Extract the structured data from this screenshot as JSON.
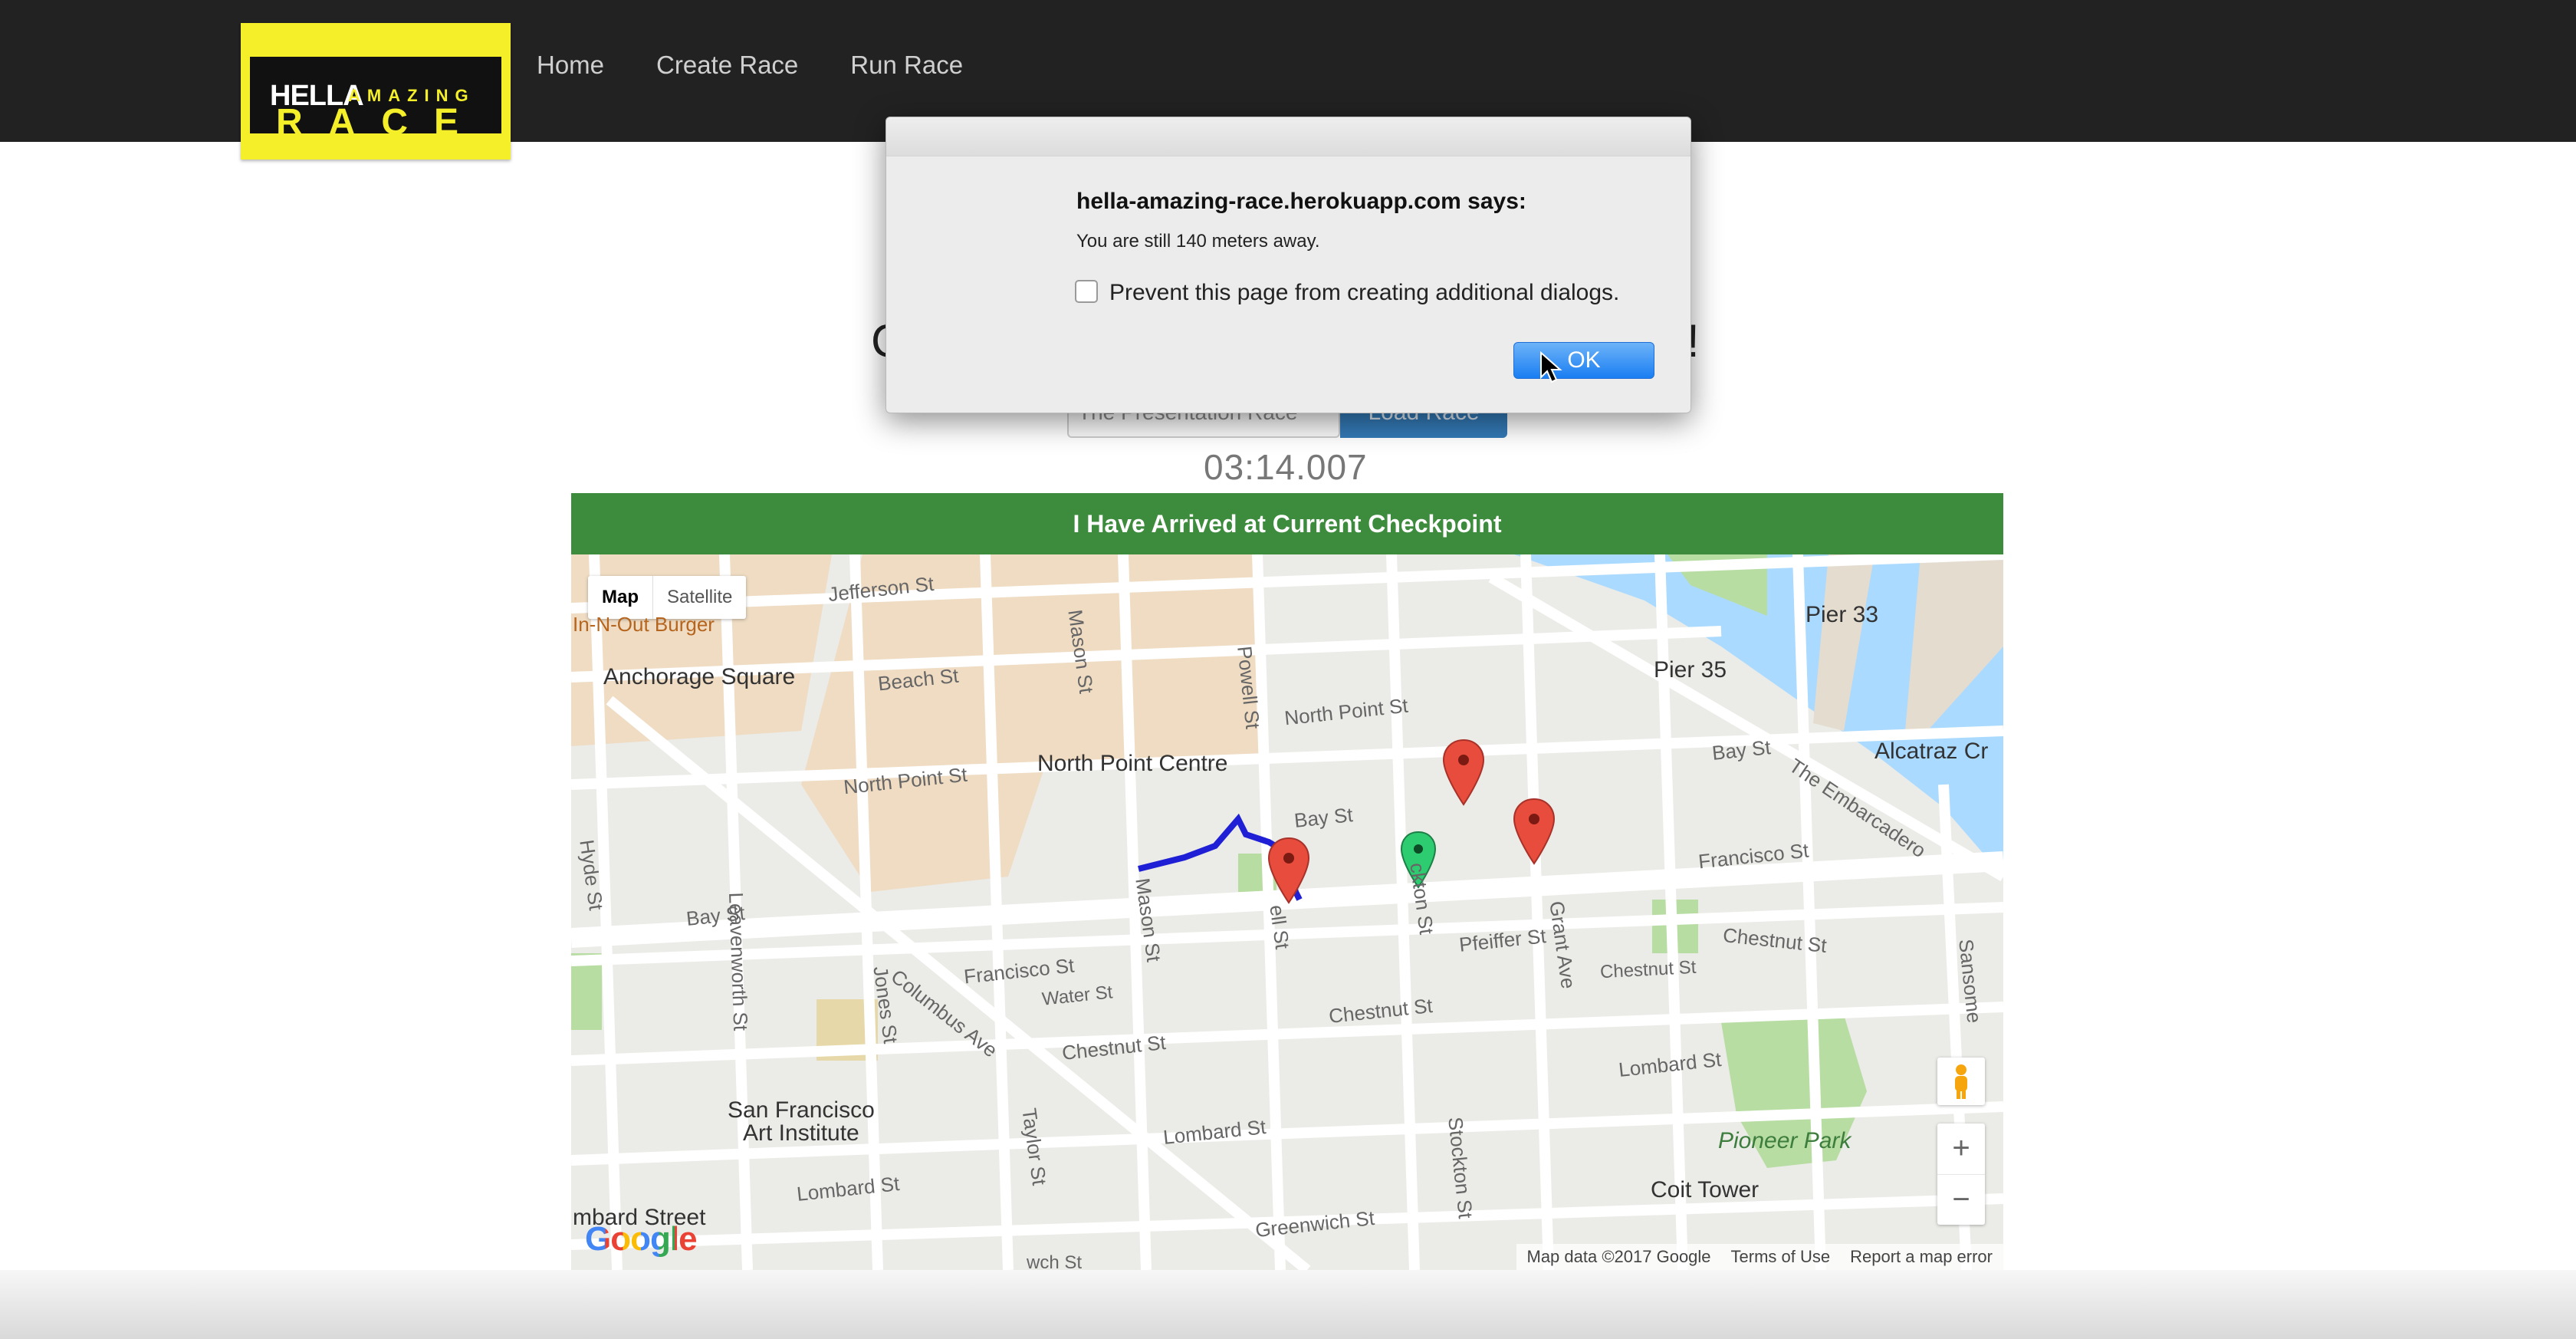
{
  "nav": {
    "logo": {
      "top": "HELLA",
      "amazing": "AMAZING",
      "bottom": "RACE"
    },
    "links": [
      "Home",
      "Create Race",
      "Run Race"
    ]
  },
  "page": {
    "heading_start": "C",
    "heading_end": "!",
    "race_input_value": "The Presentation Race",
    "load_button": "Load Race",
    "timer": "03:14.007",
    "arrive_button": "I Have Arrived at Current Checkpoint"
  },
  "map": {
    "type_map": "Map",
    "type_satellite": "Satellite",
    "labels": {
      "jefferson": "Jefferson St",
      "in_n_out": "In-N-Out Burger",
      "anchorage": "Anchorage Square",
      "beach": "Beach St",
      "mason_top": "Mason St",
      "powell": "Powell St",
      "north_point": "North Point St",
      "north_point_2": "North Point St",
      "npc": "North Point Centre",
      "bay_mid": "Bay St",
      "bay_right": "Bay St",
      "bay_left": "Bay St",
      "hyde": "Hyde St",
      "leavenworth": "Leavenworth St",
      "jones": "Jones St",
      "columbus": "Columbus Ave",
      "francisco_left": "Francisco St",
      "water": "Water St",
      "mason_mid": "Mason St",
      "powell_mid": "ell St",
      "stockton_mid": "ckton St",
      "pfeiffer": "Pfeiffer St",
      "grant": "Grant Ave",
      "francisco_right": "Francisco St",
      "chestnut_1": "Chestnut St",
      "chestnut_2": "Chestnut St",
      "chestnut_3": "Chestnut St",
      "chestnut_4": "Chestnut St",
      "embarcadero": "The Embarcadero",
      "pier33": "Pier 33",
      "pier35": "Pier 35",
      "alcatraz": "Alcatraz Cr",
      "sfai": "San Francisco\nArt Institute",
      "taylor": "Taylor St",
      "lombard_1": "Lombard St",
      "lombard_2": "Lombard St",
      "lombard_3": "Lombard St",
      "stockton_low": "Stockton St",
      "pioneer": "Pioneer Park",
      "coit": "Coit Tower",
      "lombard_street": "mbard Street",
      "greenwich": "Greenwich St",
      "sansome": "Sansome",
      "wch": "wch St"
    },
    "zoom_in": "+",
    "zoom_out": "−",
    "google": "Google",
    "attribution": [
      "Map data ©2017 Google",
      "Terms of Use",
      "Report a map error"
    ]
  },
  "dialog": {
    "title": "hella-amazing-race.herokuapp.com says:",
    "message": "You are still 140 meters away.",
    "checkbox_label": "Prevent this page from creating additional dialogs.",
    "ok": "OK"
  }
}
